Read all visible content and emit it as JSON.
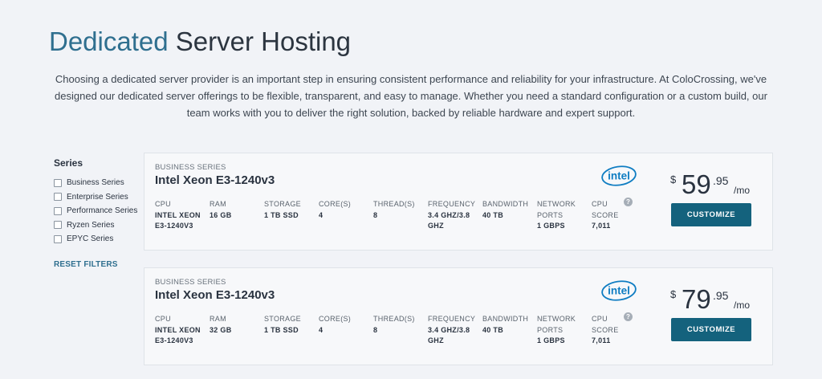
{
  "header": {
    "title_accent": "Dedicated",
    "title_rest": "Server Hosting",
    "intro": "Choosing a dedicated server provider is an important step in ensuring consistent performance and reliability for your infrastructure. At ColoCrossing, we've designed our dedicated server offerings to be flexible, transparent, and easy to manage. Whether you need a standard configuration or a custom build, our team works with you to deliver the right solution, backed by reliable hardware and expert support."
  },
  "filters": {
    "title": "Series",
    "options": [
      {
        "label": "Business Series",
        "checked": false
      },
      {
        "label": "Enterprise Series",
        "checked": false
      },
      {
        "label": "Performance Series",
        "checked": false
      },
      {
        "label": "Ryzen Series",
        "checked": false
      },
      {
        "label": "EPYC Series",
        "checked": false
      }
    ],
    "reset_label": "RESET FILTERS"
  },
  "spec_labels": {
    "cpu": "CPU",
    "ram": "RAM",
    "storage": "STORAGE",
    "cores": "CORE(S)",
    "threads": "THREAD(S)",
    "frequency": "FREQUENCY",
    "bandwidth": "BANDWIDTH",
    "network": "NETWORK PORTS",
    "score": "CPU SCORE"
  },
  "servers": [
    {
      "series": "BUSINESS SERIES",
      "name": "Intel Xeon E3-1240v3",
      "brand": "intel",
      "cpu": "INTEL XEON E3-1240V3",
      "ram": "16 GB",
      "storage": "1 TB SSD",
      "cores": "4",
      "threads": "8",
      "frequency": "3.4 GHZ/3.8 GHZ",
      "bandwidth": "40 TB",
      "network": "1 GBPS",
      "score": "7,011",
      "help": "?",
      "currency": "$",
      "price_whole": "59",
      "price_cents": ".95",
      "period": "/mo",
      "cta": "CUSTOMIZE"
    },
    {
      "series": "BUSINESS SERIES",
      "name": "Intel Xeon E3-1240v3",
      "brand": "intel",
      "cpu": "INTEL XEON E3-1240V3",
      "ram": "32 GB",
      "storage": "1 TB SSD",
      "cores": "4",
      "threads": "8",
      "frequency": "3.4 GHZ/3.8 GHZ",
      "bandwidth": "40 TB",
      "network": "1 GBPS",
      "score": "7,011",
      "help": "?",
      "currency": "$",
      "price_whole": "79",
      "price_cents": ".95",
      "period": "/mo",
      "cta": "CUSTOMIZE"
    }
  ],
  "colors": {
    "accent": "#2f6f8f",
    "button": "#14627d",
    "intel_blue": "#0f7dc2",
    "background": "#f1f3f7"
  }
}
